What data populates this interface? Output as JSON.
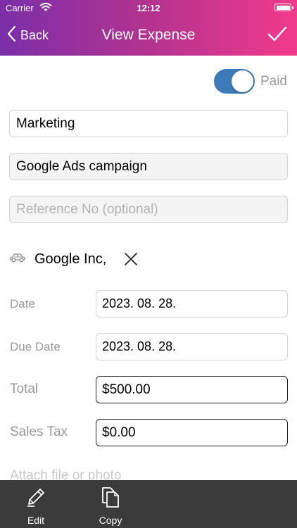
{
  "status_bar": {
    "carrier": "Carrier",
    "time": "12:12"
  },
  "nav": {
    "back_label": "Back",
    "title": "View Expense"
  },
  "paid_toggle": {
    "label": "Paid",
    "on": true
  },
  "fields": {
    "category": "Marketing",
    "description": "Google Ads campaign",
    "reference_placeholder": "Reference No (optional)"
  },
  "vendor": {
    "name": "Google Inc,"
  },
  "rows": {
    "date_label": "Date",
    "date_value": "2023. 08. 28.",
    "due_date_label": "Due Date",
    "due_date_value": "2023. 08. 28.",
    "total_label": "Total",
    "total_value": "$500.00",
    "sales_tax_label": "Sales Tax",
    "sales_tax_value": "$0.00"
  },
  "attach_label": "Attach file or photo",
  "toolbar": {
    "edit_label": "Edit",
    "copy_label": "Copy"
  },
  "colors": {
    "gradient_start": "#7a2fa8",
    "gradient_end": "#f23a8c",
    "toggle_on": "#3d7ab8",
    "toolbar_bg": "#3b3b3b"
  }
}
